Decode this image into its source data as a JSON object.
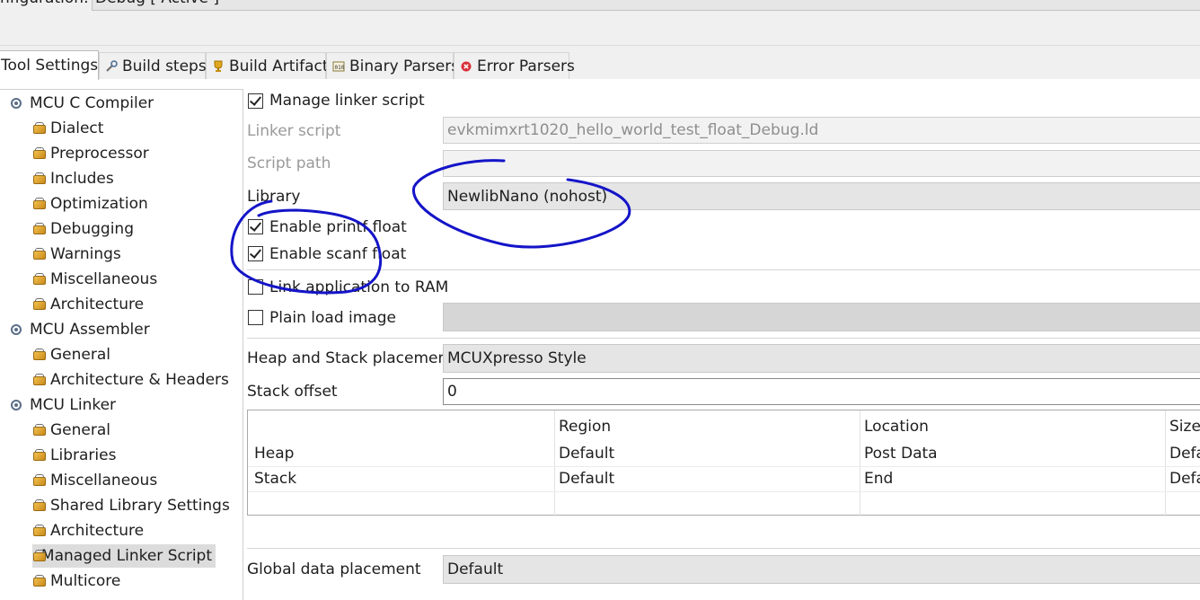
{
  "config": {
    "label": "nfiguration:",
    "value": "Debug  [ Active ]"
  },
  "tabs": [
    {
      "label": "Tool Settings",
      "icon": "none",
      "active": true
    },
    {
      "label": "Build steps",
      "icon": "build-steps-icon",
      "active": false
    },
    {
      "label": "Build Artifact",
      "icon": "trophy-icon",
      "active": false
    },
    {
      "label": "Binary Parsers",
      "icon": "binary-parsers-icon",
      "active": false
    },
    {
      "label": "Error Parsers",
      "icon": "error-icon",
      "active": false
    }
  ],
  "tree": [
    {
      "label": "MCU C Compiler",
      "level": 0
    },
    {
      "label": "Dialect",
      "level": 1
    },
    {
      "label": "Preprocessor",
      "level": 1
    },
    {
      "label": "Includes",
      "level": 1
    },
    {
      "label": "Optimization",
      "level": 1
    },
    {
      "label": "Debugging",
      "level": 1
    },
    {
      "label": "Warnings",
      "level": 1
    },
    {
      "label": "Miscellaneous",
      "level": 1
    },
    {
      "label": "Architecture",
      "level": 1
    },
    {
      "label": "MCU Assembler",
      "level": 0
    },
    {
      "label": "General",
      "level": 1
    },
    {
      "label": "Architecture & Headers",
      "level": 1
    },
    {
      "label": "MCU Linker",
      "level": 0
    },
    {
      "label": "General",
      "level": 1
    },
    {
      "label": "Libraries",
      "level": 1
    },
    {
      "label": "Miscellaneous",
      "level": 1
    },
    {
      "label": "Shared Library Settings",
      "level": 1
    },
    {
      "label": "Architecture",
      "level": 1
    },
    {
      "label": "Managed Linker Script",
      "level": 1,
      "selected": true
    },
    {
      "label": "Multicore",
      "level": 1
    }
  ],
  "settings": {
    "manage_linker_script": {
      "label": "Manage linker script",
      "checked": true
    },
    "linker_script": {
      "label": "Linker script",
      "value": "evkmimxrt1020_hello_world_test_float_Debug.ld"
    },
    "script_path": {
      "label": "Script path",
      "value": ""
    },
    "library": {
      "label": "Library",
      "value": "NewlibNano (nohost)"
    },
    "enable_printf_float": {
      "label": "Enable printf float",
      "checked": true
    },
    "enable_scanf_float": {
      "label": "Enable scanf float",
      "checked": true
    },
    "link_to_ram": {
      "label": "Link application to RAM",
      "checked": false
    },
    "plain_load_image": {
      "label": "Plain load image",
      "checked": false,
      "value": ""
    },
    "heap_stack_placement": {
      "label": "Heap and Stack placement",
      "value": "MCUXpresso Style"
    },
    "stack_offset": {
      "label": "Stack offset",
      "value": "0"
    },
    "global_data_placement": {
      "label": "Global data placement",
      "value": "Default"
    }
  },
  "placement_table": {
    "columns": [
      "",
      "Region",
      "Location",
      "Size"
    ],
    "rows": [
      [
        "Heap",
        "Default",
        "Post Data",
        "Defa"
      ],
      [
        "Stack",
        "Default",
        "End",
        "Defa"
      ]
    ]
  },
  "annotation": {
    "color": "#1414c8"
  }
}
